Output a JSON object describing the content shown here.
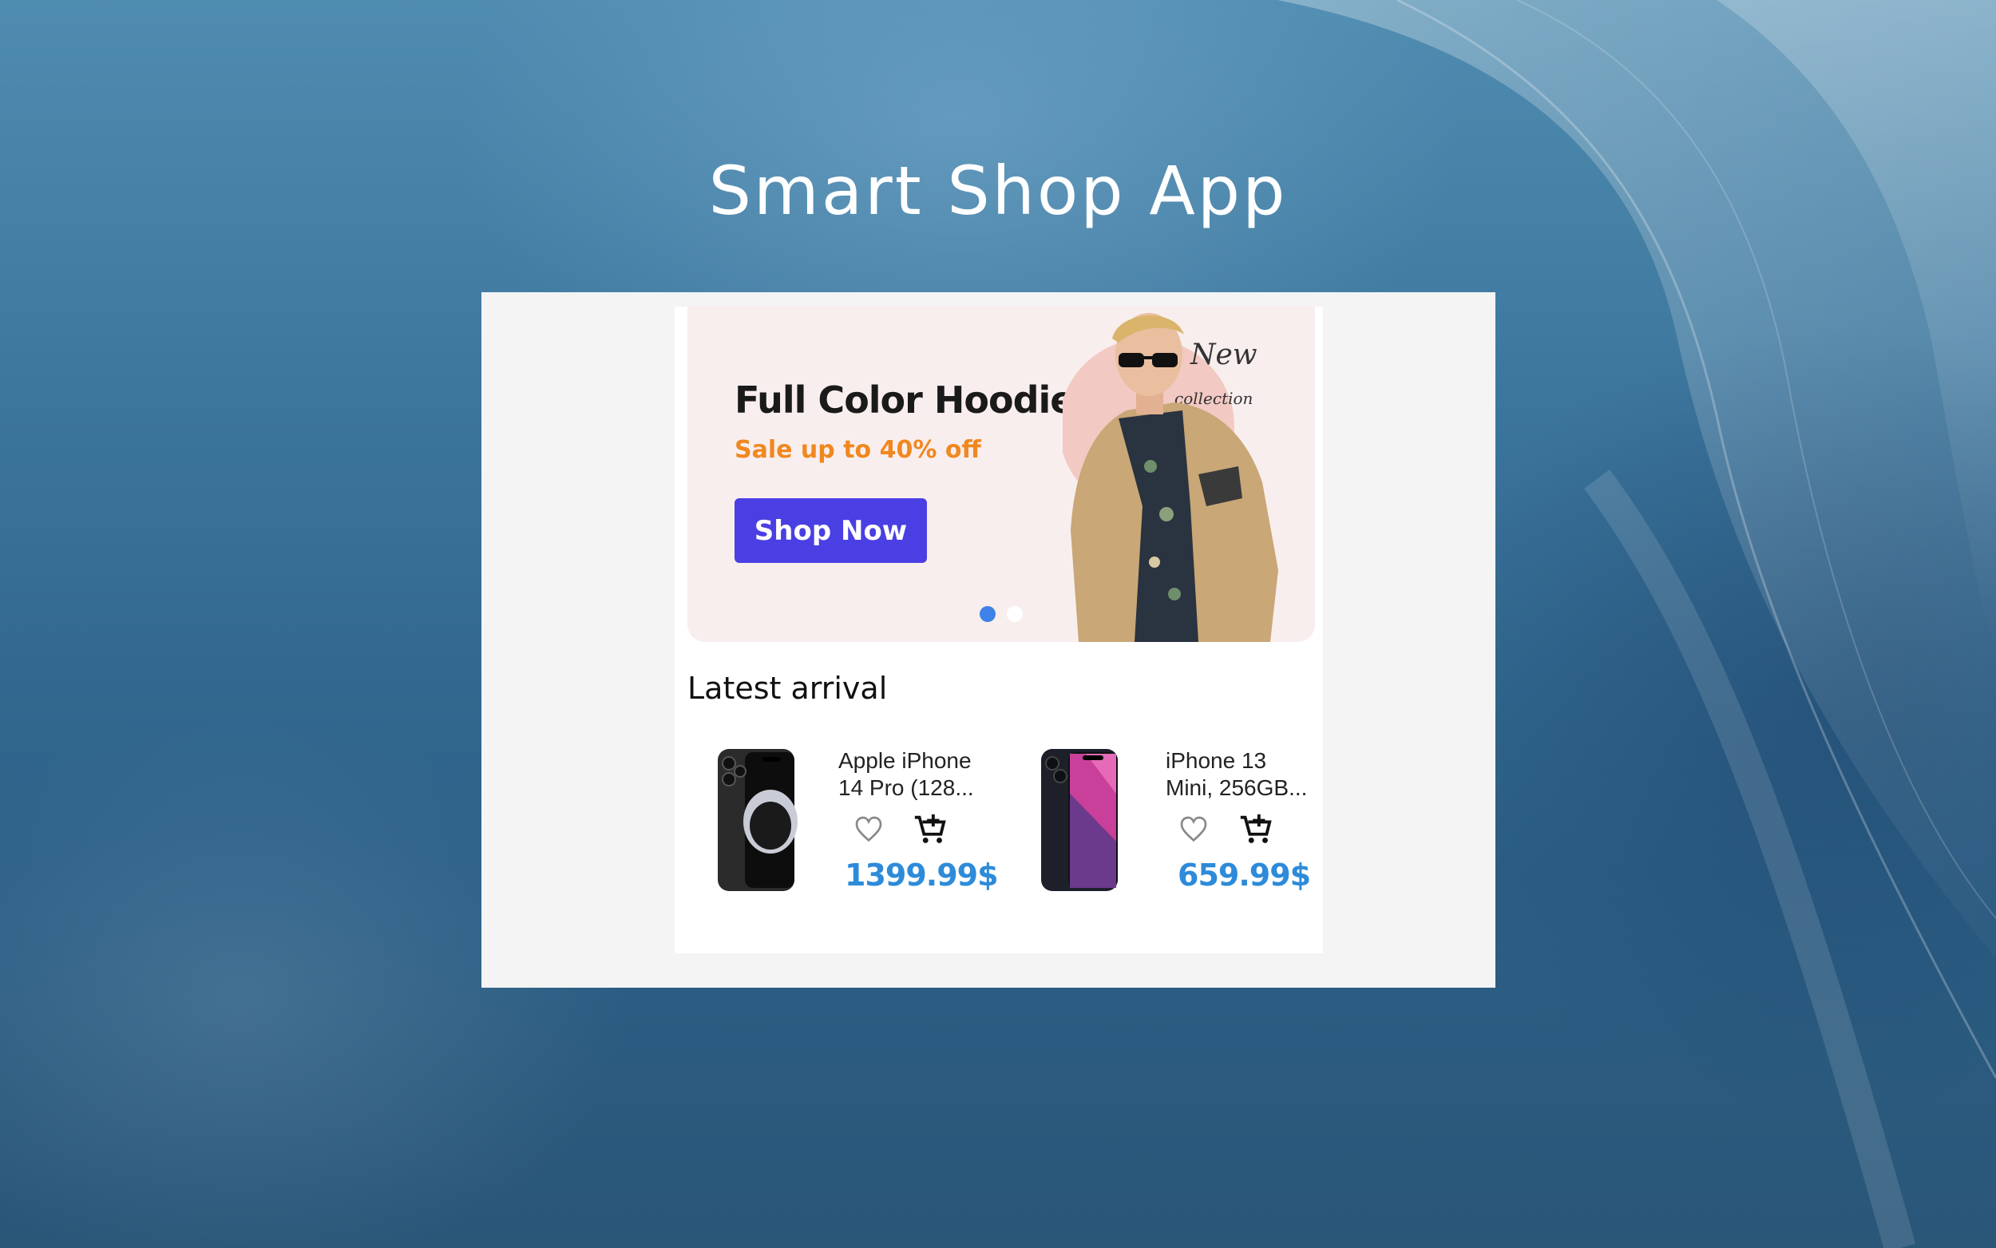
{
  "page": {
    "title": "Smart Shop App"
  },
  "banner": {
    "title": "Full Color Hoodie",
    "subtitle": "Sale up to 40% off",
    "button_label": "Shop Now",
    "badge_line1": "New",
    "badge_line2": "collection",
    "carousel_count": 2,
    "carousel_active": 1,
    "accent_color": "#4a3fe3",
    "subtitle_color": "#f0881f"
  },
  "latest": {
    "title": "Latest arrival",
    "products": [
      {
        "name": "Apple iPhone\n14 Pro (128...",
        "price": "1399.99$",
        "favorite_icon": "heart-outline-icon",
        "cart_icon": "add-to-cart-icon"
      },
      {
        "name": "iPhone 13\nMini, 256GB...",
        "price": "659.99$",
        "favorite_icon": "heart-outline-icon",
        "cart_icon": "add-to-cart-icon"
      }
    ],
    "price_color": "#2d8bd9"
  }
}
